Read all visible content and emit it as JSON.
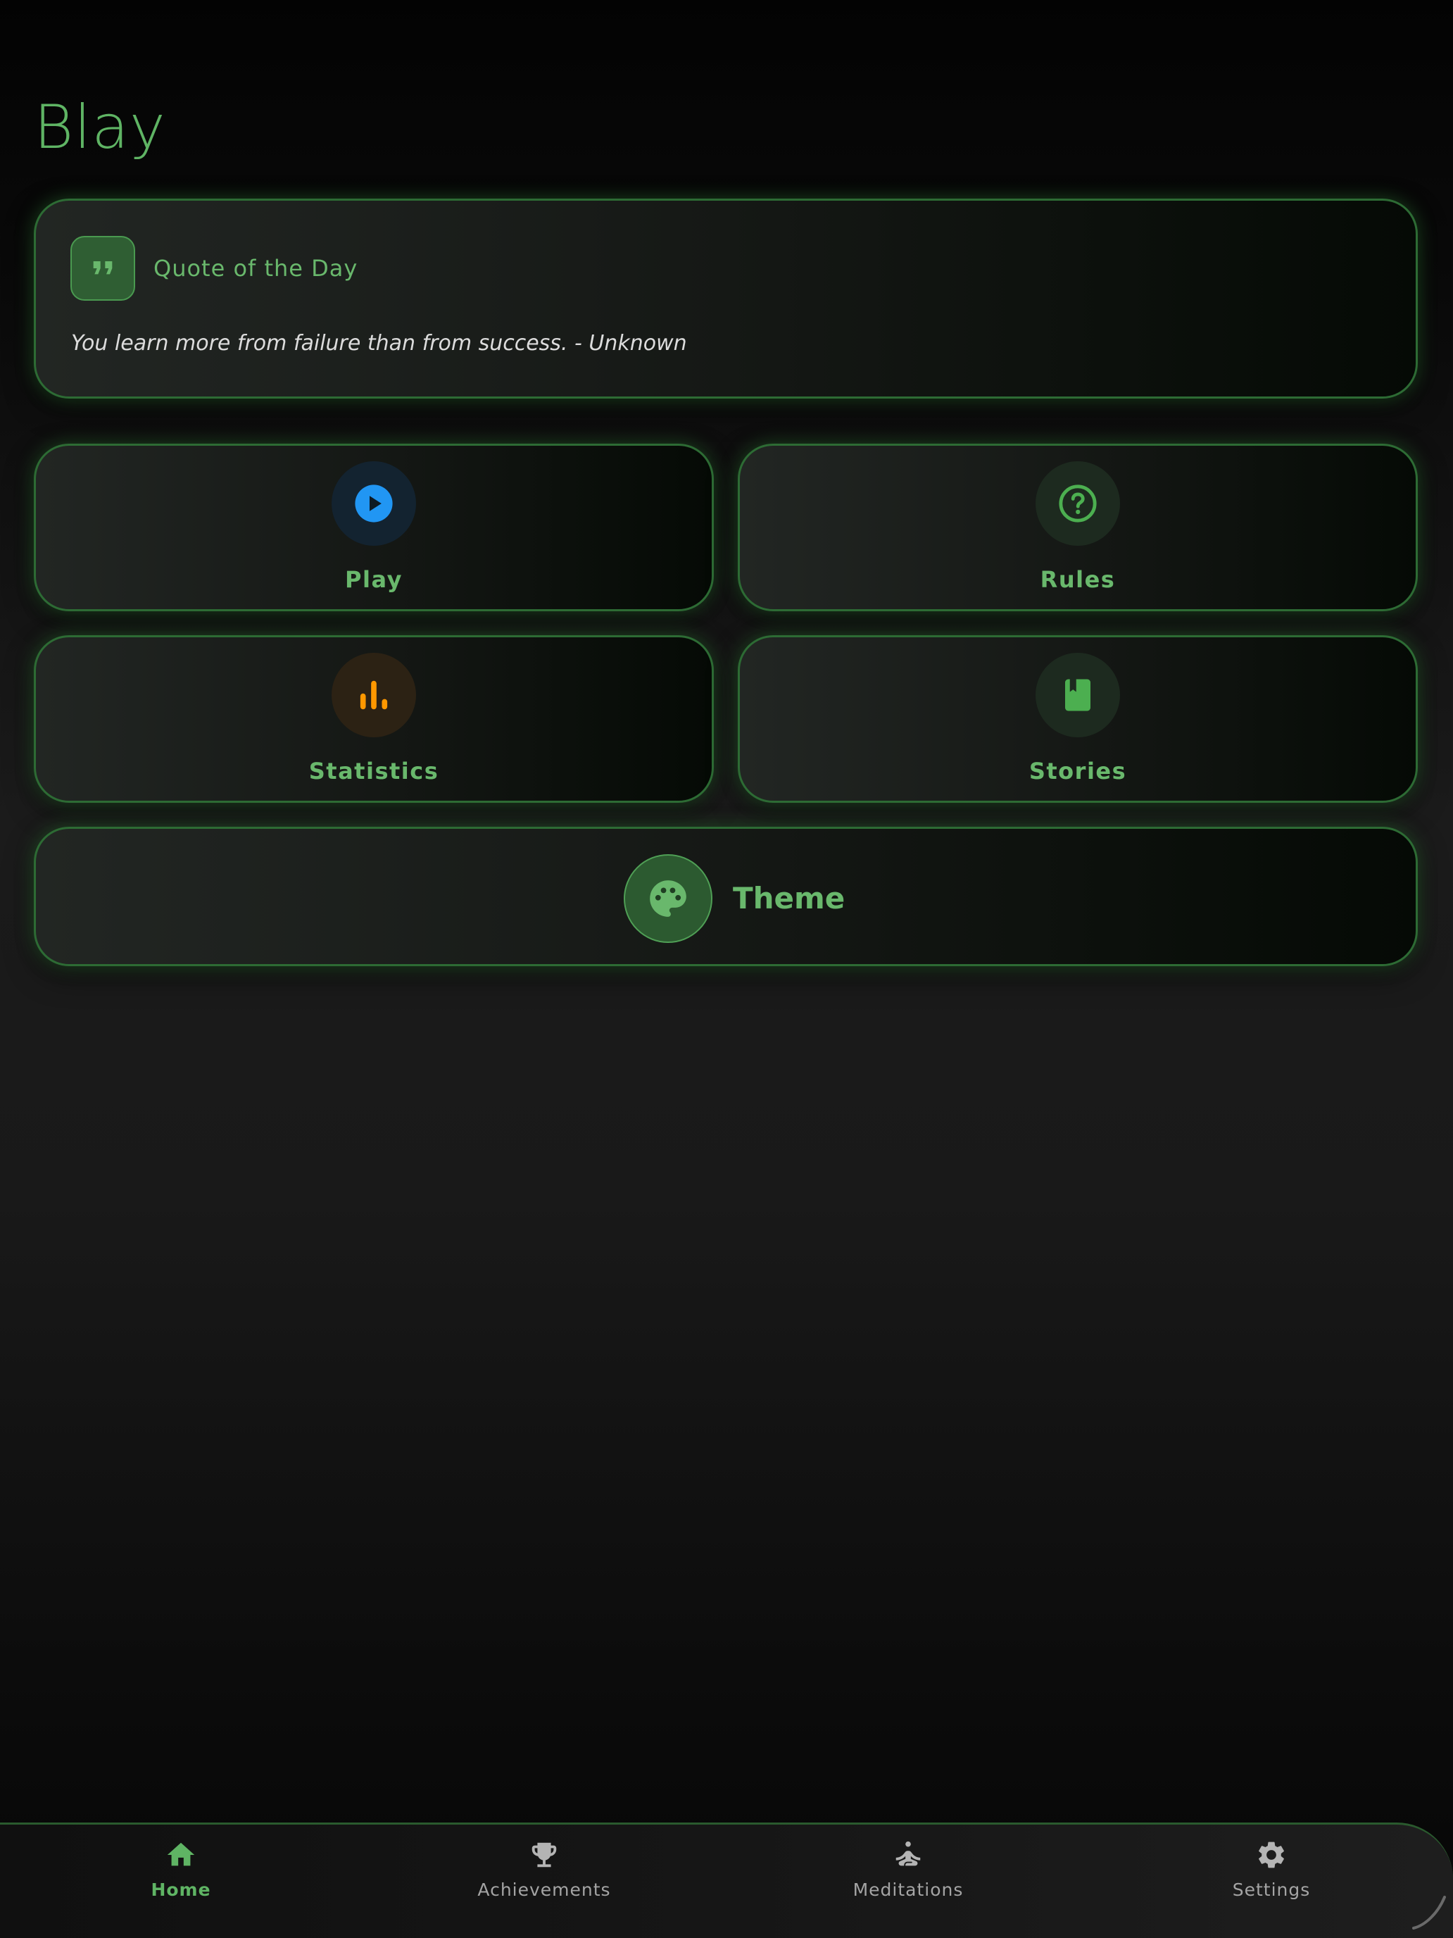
{
  "app": {
    "title": "Blay"
  },
  "quote": {
    "icon": "format-quote-icon",
    "title": "Quote of the Day",
    "text": "You learn more from failure than from success. - Unknown"
  },
  "tiles": [
    {
      "label": "Play",
      "icon": "play-circle-icon",
      "color": "#2196f3"
    },
    {
      "label": "Rules",
      "icon": "help-circle-icon",
      "color": "#4caf50"
    },
    {
      "label": "Statistics",
      "icon": "bar-chart-icon",
      "color": "#ff9800"
    },
    {
      "label": "Stories",
      "icon": "book-icon",
      "color": "#4caf50"
    }
  ],
  "theme": {
    "label": "Theme",
    "icon": "palette-icon"
  },
  "nav": {
    "items": [
      {
        "label": "Home",
        "icon": "home-icon",
        "active": true
      },
      {
        "label": "Achievements",
        "icon": "trophy-icon",
        "active": false
      },
      {
        "label": "Meditations",
        "icon": "meditation-icon",
        "active": false
      },
      {
        "label": "Settings",
        "icon": "gear-icon",
        "active": false
      }
    ]
  },
  "colors": {
    "accent": "#69b86c",
    "border": "#2d6b34",
    "background": "#121212",
    "inactive_nav": "#a4a4a4"
  }
}
